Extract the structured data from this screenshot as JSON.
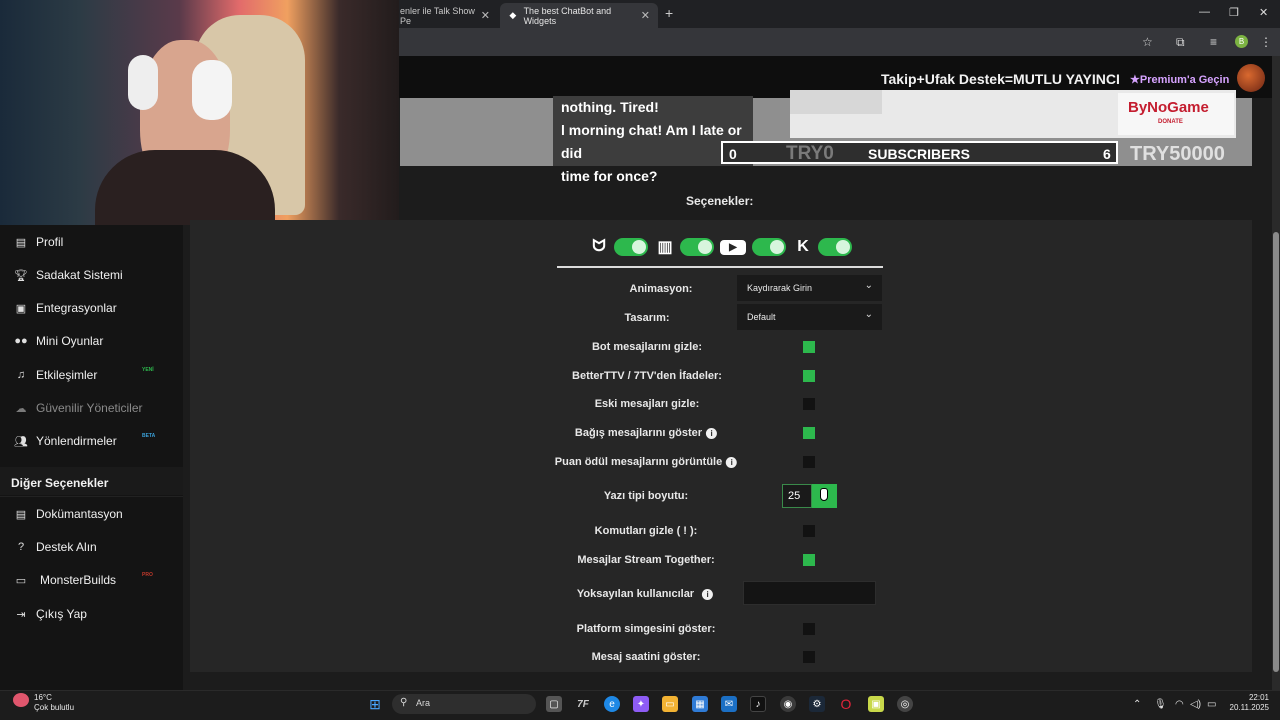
{
  "browser": {
    "tabs": [
      {
        "title": "enler ile Talk Show Pe"
      },
      {
        "title": "The best ChatBot and Widgets",
        "active": true
      }
    ],
    "new_tab": "+",
    "profile": "B"
  },
  "header": {
    "promo_text": "Takip+Ufak Destek=MUTLU YAYINCI",
    "premium_label": "Premium'a Geçin"
  },
  "preview": {
    "chat_lines": [
      "nothing. Tired!",
      "l morning chat! Am I late or did",
      "time for once?"
    ],
    "donation_brand": "ByNoGame",
    "donation_sub": "DONATE",
    "goal_left": "0",
    "goal_currency_left": "TRY0",
    "goal_label": "SUBSCRIBERS",
    "goal_count": "6",
    "goal_target": "TRY50000"
  },
  "sidebar": {
    "items": [
      {
        "label": "Profil",
        "icon": "id-card-icon"
      },
      {
        "label": "Sadakat Sistemi",
        "icon": "trophy-icon"
      },
      {
        "label": "Entegrasyonlar",
        "icon": "integration-icon"
      },
      {
        "label": "Mini Oyunlar",
        "icon": "gamepad-icon"
      },
      {
        "label": "Etkileşimler",
        "icon": "music-note-icon",
        "badge": "YENİ",
        "badge_color": "#2db84d"
      },
      {
        "label": "Güvenilir Yöneticiler",
        "icon": "users-icon",
        "disabled": true
      },
      {
        "label": "Yönlendirmeler",
        "icon": "users-icon",
        "badge": "BETA",
        "badge_color": "#3aa0d8"
      }
    ],
    "section_title": "Diğer Seçenekler",
    "other_items": [
      {
        "label": "Dokümantasyon",
        "icon": "document-icon"
      },
      {
        "label": "Destek Alın",
        "icon": "help-icon"
      },
      {
        "label": "MonsterBuilds",
        "icon": "monitor-icon",
        "badge": "PRO",
        "badge_color": "#c0392b"
      },
      {
        "label": "Çıkış Yap",
        "icon": "logout-icon"
      }
    ]
  },
  "options": {
    "title": "Seçenekler:",
    "platforms": [
      {
        "name": "kick-alt-icon",
        "enabled": true
      },
      {
        "name": "twitch-icon",
        "enabled": true
      },
      {
        "name": "youtube-icon",
        "enabled": true
      },
      {
        "name": "kick-icon",
        "enabled": true
      }
    ],
    "animation_label": "Animasyon:",
    "animation_value": "Kaydırarak Girin",
    "design_label": "Tasarım:",
    "design_value": "Default",
    "checks": [
      {
        "label": "Bot mesajlarını gizle:",
        "checked": true
      },
      {
        "label": "BetterTTV / 7TV'den İfadeler:",
        "checked": true
      },
      {
        "label": "Eski mesajları gizle:",
        "checked": false
      },
      {
        "label": "Bağış mesajlarını göster",
        "checked": true,
        "info": true
      },
      {
        "label": "Puan ödül mesajlarını görüntüle",
        "checked": false,
        "info": true
      }
    ],
    "font_size_label": "Yazı tipi boyutu:",
    "font_size_value": "25",
    "stepper_symbol": "+",
    "checks2": [
      {
        "label": "Komutları gizle ( ! ):",
        "checked": false
      },
      {
        "label": "Mesajlar Stream Together:",
        "checked": true
      }
    ],
    "ignored_label": "Yoksayılan kullanıcılar",
    "ignored_value": "",
    "checks3": [
      {
        "label": "Platform simgesini göster:",
        "checked": false
      },
      {
        "label": "Mesaj saatini göster:",
        "checked": false
      }
    ],
    "info_symbol": "i"
  },
  "taskbar": {
    "temperature": "16°C",
    "weather": "Çok bulutlu",
    "search_placeholder": "Ara",
    "time": "22:01",
    "date": "20.11.2025"
  },
  "colors": {
    "accent": "#2db84d",
    "panel": "#262626",
    "sidebar": "#141414"
  }
}
